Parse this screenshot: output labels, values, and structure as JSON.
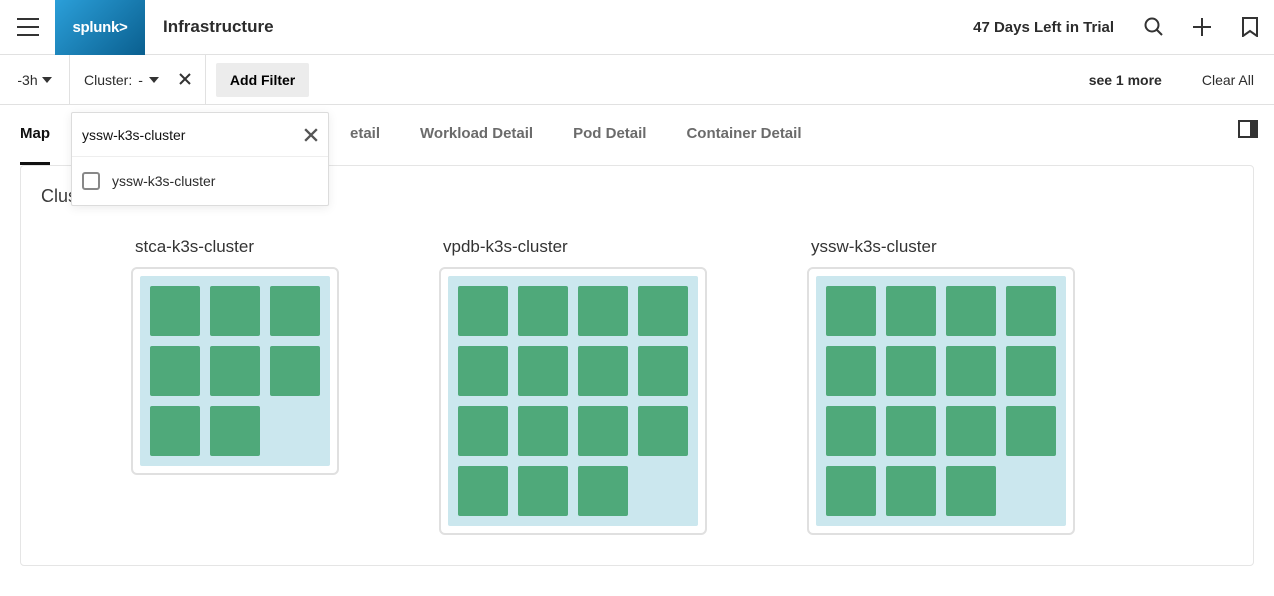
{
  "header": {
    "brand": "splunk>",
    "page_title": "Infrastructure",
    "trial_text": "47 Days Left in Trial"
  },
  "filter_bar": {
    "time_picker": "-3h",
    "cluster_label": "Cluster:",
    "cluster_value": "-",
    "add_filter": "Add Filter",
    "see_more": "see 1 more",
    "clear_all": "Clear All"
  },
  "filter_dropdown": {
    "input_value": "yssw-k3s-cluster",
    "options": [
      {
        "label": "yssw-k3s-cluster",
        "checked": false
      }
    ]
  },
  "tabs": [
    {
      "label": "Map",
      "active": true
    },
    {
      "label": "etail",
      "partial": true
    },
    {
      "label": "Workload Detail"
    },
    {
      "label": "Pod Detail"
    },
    {
      "label": "Container Detail"
    }
  ],
  "main": {
    "section_title": "Cluster Map",
    "clusters": [
      {
        "name": "stca-k3s-cluster",
        "cols": 3,
        "pods": 8
      },
      {
        "name": "vpdb-k3s-cluster",
        "cols": 4,
        "pods": 15
      },
      {
        "name": "yssw-k3s-cluster",
        "cols": 4,
        "pods": 15
      }
    ]
  }
}
